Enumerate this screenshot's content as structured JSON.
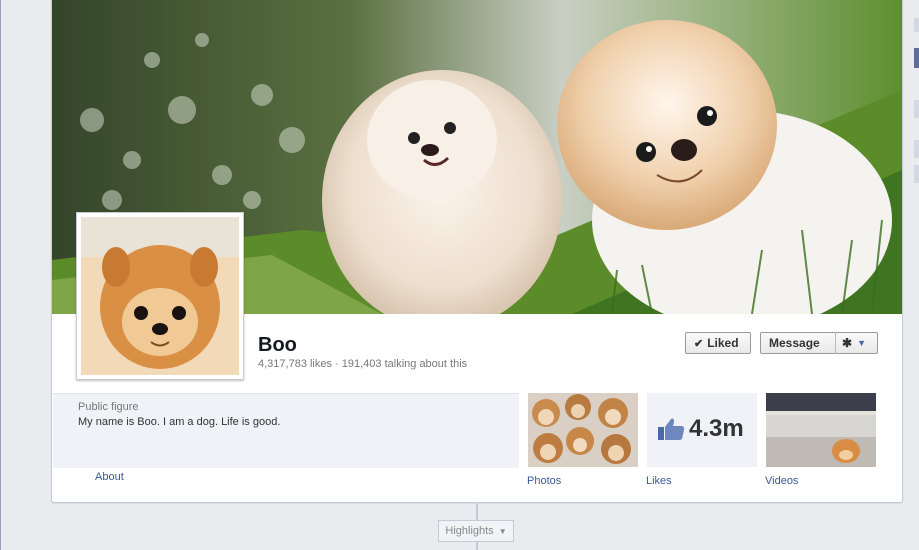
{
  "page": {
    "name": "Boo",
    "stats": "4,317,783 likes · 191,403 talking about this"
  },
  "actions": {
    "liked_label": "Liked",
    "message_label": "Message"
  },
  "info": {
    "category": "Public figure",
    "about_text": "My name is Boo. I am a dog. Life is good.",
    "about_link": "About"
  },
  "tiles": {
    "photos_label": "Photos",
    "likes_label": "Likes",
    "likes_count": "4.3m",
    "videos_label": "Videos"
  },
  "timeline": {
    "highlights_label": "Highlights"
  },
  "colors": {
    "link": "#3b5998",
    "background": "#e9ebee",
    "panel": "#f0f2f7"
  }
}
